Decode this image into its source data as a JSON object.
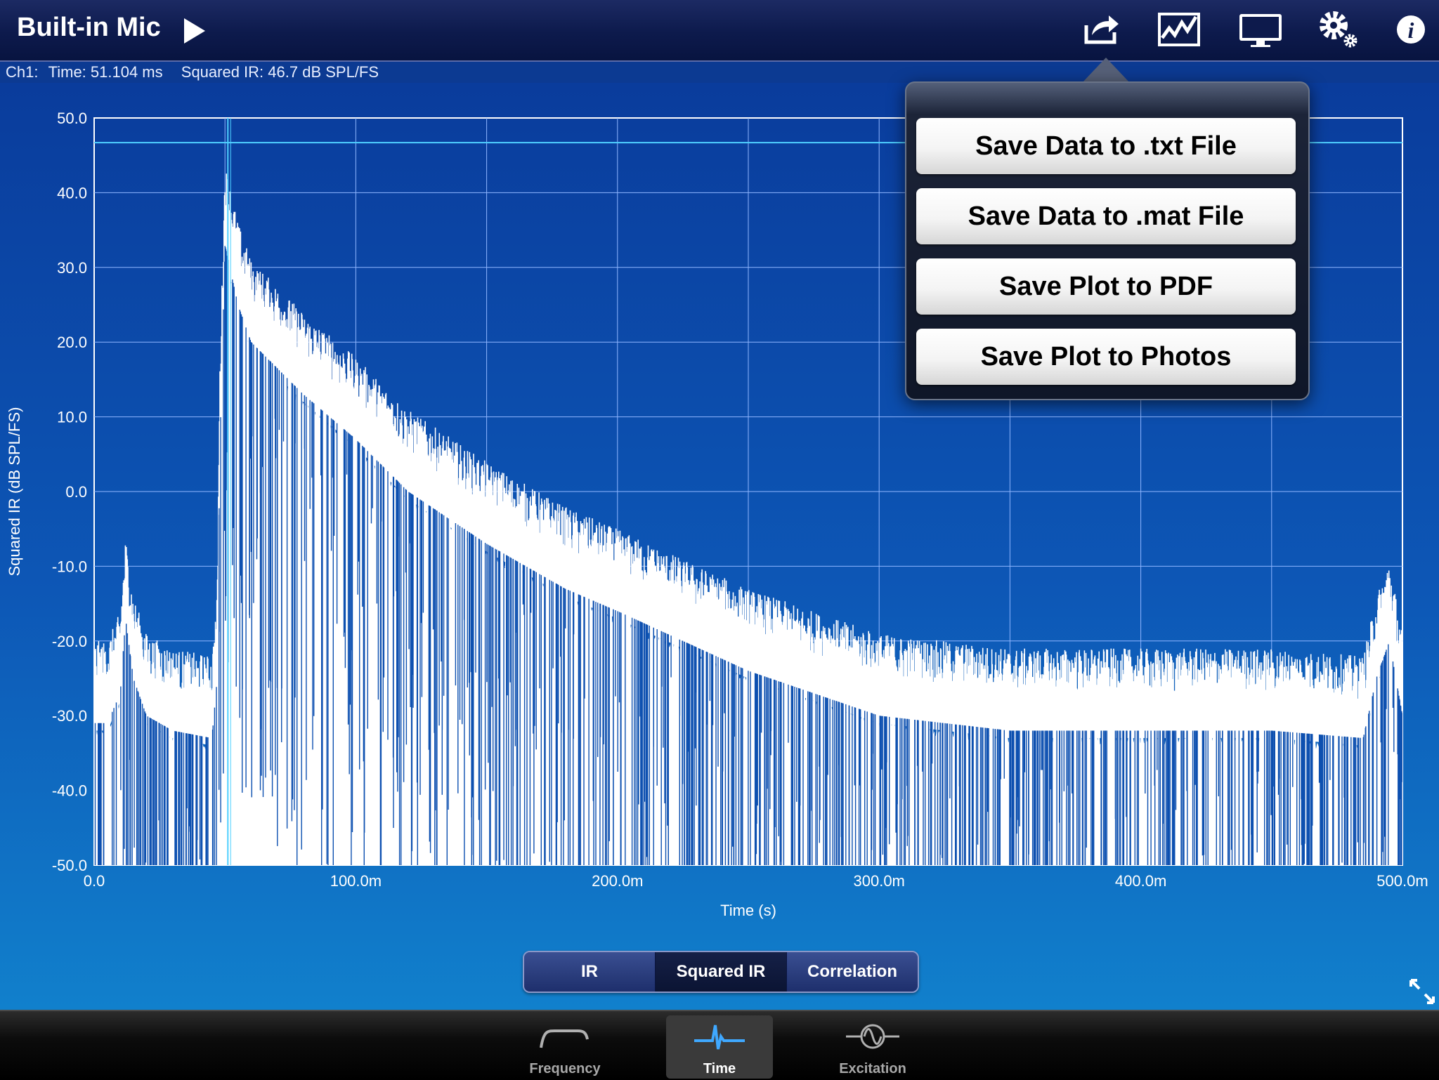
{
  "header": {
    "title": "Built-in Mic",
    "icons": [
      "play-icon",
      "share-icon",
      "chart-icon",
      "monitor-icon",
      "settings-icon",
      "info-icon"
    ]
  },
  "status": {
    "channel": "Ch1:",
    "time": "Time: 51.104 ms",
    "value": "Squared IR: 46.7 dB SPL/FS"
  },
  "popover": {
    "items": [
      "Save Data to .txt File",
      "Save Data to .mat File",
      "Save Plot to PDF",
      "Save Plot to Photos"
    ]
  },
  "segments": {
    "items": [
      "IR",
      "Squared IR",
      "Correlation"
    ],
    "selected": "Squared IR"
  },
  "tabs": {
    "items": [
      "Frequency",
      "Time",
      "Excitation"
    ],
    "selected": "Time"
  },
  "colors": {
    "accent": "#0a3e9a",
    "trace": "#ffffff",
    "cursor": "#4fd0ff",
    "grid": "#8fb6ff"
  },
  "chart_data": {
    "type": "line",
    "xlabel": "Time (s)",
    "ylabel": "Squared IR (dB SPL/FS)",
    "xlim": [
      0,
      0.5
    ],
    "ylim": [
      -50,
      50
    ],
    "x_ticks": [
      "0.0",
      "100.0m",
      "200.0m",
      "300.0m",
      "400.0m",
      "500.0m"
    ],
    "y_ticks": [
      "50.0",
      "40.0",
      "30.0",
      "20.0",
      "10.0",
      "0.0",
      "-10.0",
      "-20.0",
      "-30.0",
      "-40.0",
      "-50.0"
    ],
    "cursor": {
      "time_s": 0.0511,
      "value_db": 46.7
    },
    "grid": true,
    "series": [
      {
        "envelope_x": [
          0.0,
          0.005,
          0.01,
          0.012,
          0.015,
          0.02,
          0.03,
          0.045,
          0.047,
          0.048,
          0.05,
          0.055,
          0.06,
          0.08,
          0.1,
          0.12,
          0.15,
          0.18,
          0.2,
          0.25,
          0.3,
          0.35,
          0.4,
          0.45,
          0.485,
          0.49,
          0.495,
          0.5
        ],
        "envelope_y": [
          -26,
          -26,
          -22,
          -12,
          -20,
          -25,
          -27,
          -28,
          -20,
          10,
          38,
          30,
          25,
          18,
          12,
          5,
          -2,
          -8,
          -11,
          -19,
          -25,
          -27,
          -27,
          -27,
          -28,
          -20,
          -15,
          -25
        ]
      }
    ]
  }
}
